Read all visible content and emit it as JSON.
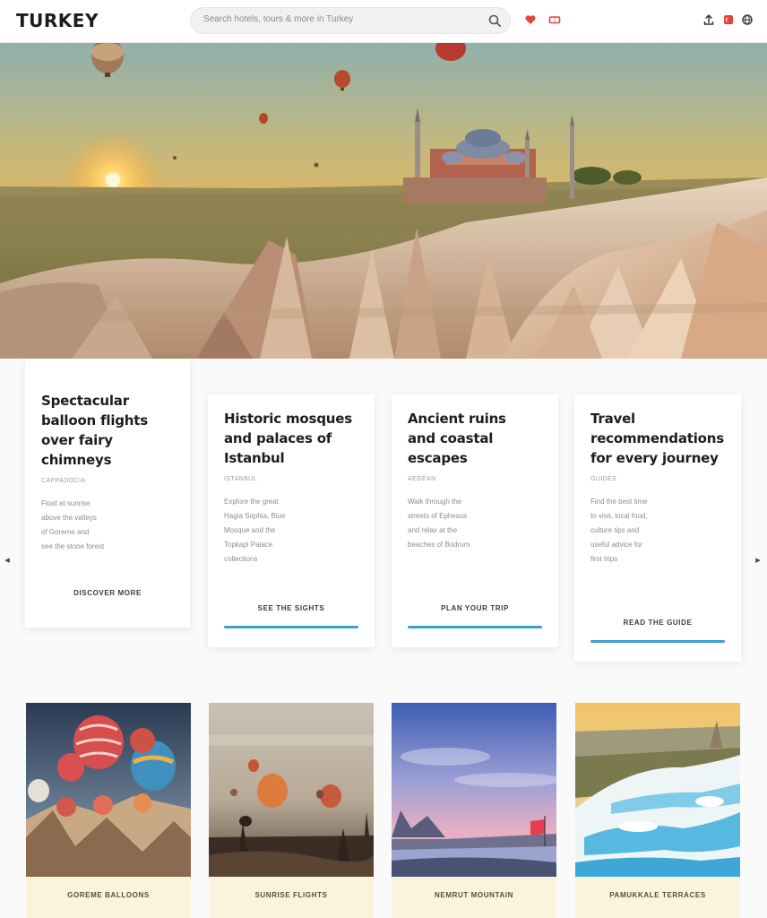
{
  "header": {
    "logo": "TURKEY",
    "search_placeholder": "Search hotels, tours & more in Turkey"
  },
  "cards": [
    {
      "title": "Spectacular\nballoon flights\nover fairy\nchimneys",
      "meta": "CAPPADOCIA",
      "body": "Float at sunrise\nabove the valleys\nof Goreme and\nsee the stone forest",
      "link": "DISCOVER MORE"
    },
    {
      "title": "Historic mosques\nand palaces of\nIstanbul",
      "meta": "ISTANBUL",
      "body": "Explore the great\nHagia Sophia, Blue\nMosque and the\nTopkapi Palace\ncollections",
      "link": "SEE THE SIGHTS",
      "has_bar": true
    },
    {
      "title": "Ancient ruins\nand coastal\nescapes",
      "meta": "AEGEAN",
      "body": "Walk through the\nstreets of Ephesus\nand relax at the\nbeaches of Bodrum",
      "link": "PLAN YOUR TRIP",
      "has_bar": true
    },
    {
      "title": "Travel\nrecommendations\nfor every journey",
      "meta": "GUIDES",
      "body": "Find the best time\nto visit, local food,\nculture tips and\nuseful advice for\nfirst trips",
      "link": "READ THE GUIDE",
      "has_bar": true
    }
  ],
  "nav": {
    "prev_icon": "chevron-left-icon",
    "next_icon": "chevron-right-icon"
  },
  "tiles": [
    {
      "caption": "GOREME BALLOONS"
    },
    {
      "caption": "SUNRISE FLIGHTS"
    },
    {
      "caption": "NEMRUT MOUNTAIN"
    },
    {
      "caption": "PAMUKKALE TERRACES"
    }
  ],
  "colors": {
    "accent": "#3aa0cc",
    "header_icon_red": "#e0443a",
    "tile_caption_bg": "#fbf4dd"
  }
}
